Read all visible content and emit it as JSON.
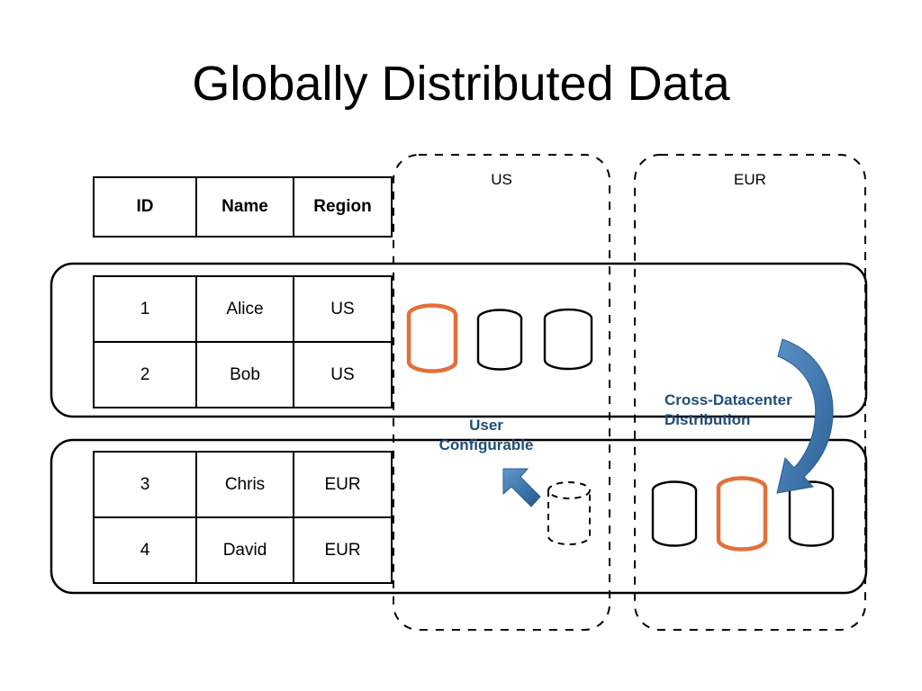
{
  "slide": {
    "title": "Globally Distributed Data"
  },
  "table": {
    "headers": [
      "ID",
      "Name",
      "Region"
    ],
    "us_rows": [
      [
        "1",
        "Alice",
        "US"
      ],
      [
        "2",
        "Bob",
        "US"
      ]
    ],
    "eur_rows": [
      [
        "3",
        "Chris",
        "EUR"
      ],
      [
        "4",
        "David",
        "EUR"
      ]
    ]
  },
  "regions": [
    {
      "label": "US"
    },
    {
      "label": "EUR"
    }
  ],
  "annotations": {
    "user_configurable_line1": "User",
    "user_configurable_line2": "Configurable",
    "cross_datacenter_line1": "Cross-Datacenter",
    "cross_datacenter_line2": "Distribution"
  },
  "colors": {
    "accent_orange": "#E2703A",
    "accent_blue": "#3C6FA6",
    "annotation_blue": "#1F4E79",
    "stroke_black": "#000000",
    "background": "#FFFFFF"
  },
  "databases": {
    "us_top": [
      {
        "id": "us-db-1",
        "style": "orange",
        "highlighted": true
      },
      {
        "id": "us-db-2",
        "style": "black",
        "highlighted": false
      },
      {
        "id": "us-db-3",
        "style": "black",
        "highlighted": false
      }
    ],
    "us_bottom": [
      {
        "id": "us-db-placeholder",
        "style": "dashed",
        "highlighted": false
      }
    ],
    "eur_bottom": [
      {
        "id": "eur-db-1",
        "style": "black",
        "highlighted": false
      },
      {
        "id": "eur-db-2",
        "style": "orange",
        "highlighted": true
      },
      {
        "id": "eur-db-3",
        "style": "black",
        "highlighted": false
      }
    ]
  }
}
